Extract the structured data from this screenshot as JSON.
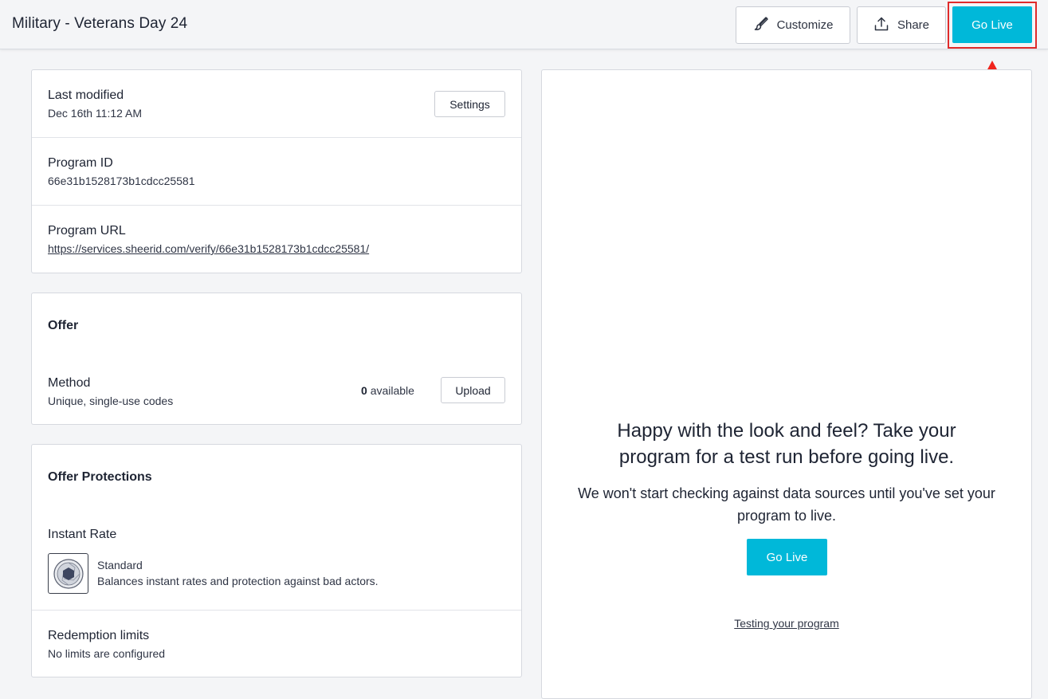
{
  "header": {
    "title": "Military - Veterans Day 24",
    "customize_label": "Customize",
    "share_label": "Share",
    "go_live_label": "Go Live"
  },
  "details": {
    "last_modified_label": "Last modified",
    "last_modified_value": "Dec 16th 11:12 AM",
    "settings_label": "Settings",
    "program_id_label": "Program ID",
    "program_id_value": "66e31b1528173b1cdcc25581",
    "program_url_label": "Program URL",
    "program_url_value": "https://services.sheerid.com/verify/66e31b1528173b1cdcc25581/"
  },
  "offer": {
    "title": "Offer",
    "method_label": "Method",
    "method_value": "Unique, single-use codes",
    "available_count": "0",
    "available_label": "available",
    "upload_label": "Upload"
  },
  "protections": {
    "title": "Offer Protections",
    "instant_rate_label": "Instant Rate",
    "rate_name": "Standard",
    "rate_description": "Balances instant rates and protection against bad actors.",
    "rate_icon": "shield-aperture-icon",
    "redemption_label": "Redemption limits",
    "redemption_value": "No limits are configured"
  },
  "preview": {
    "headline": "Happy with the look and feel? Take your program for a test run before going live.",
    "body": "We won't start checking against data sources until you've set your program to live.",
    "go_live_label": "Go Live",
    "testing_link": "Testing your program"
  },
  "colors": {
    "accent": "#00b8d9",
    "highlight": "#e02b2b"
  }
}
